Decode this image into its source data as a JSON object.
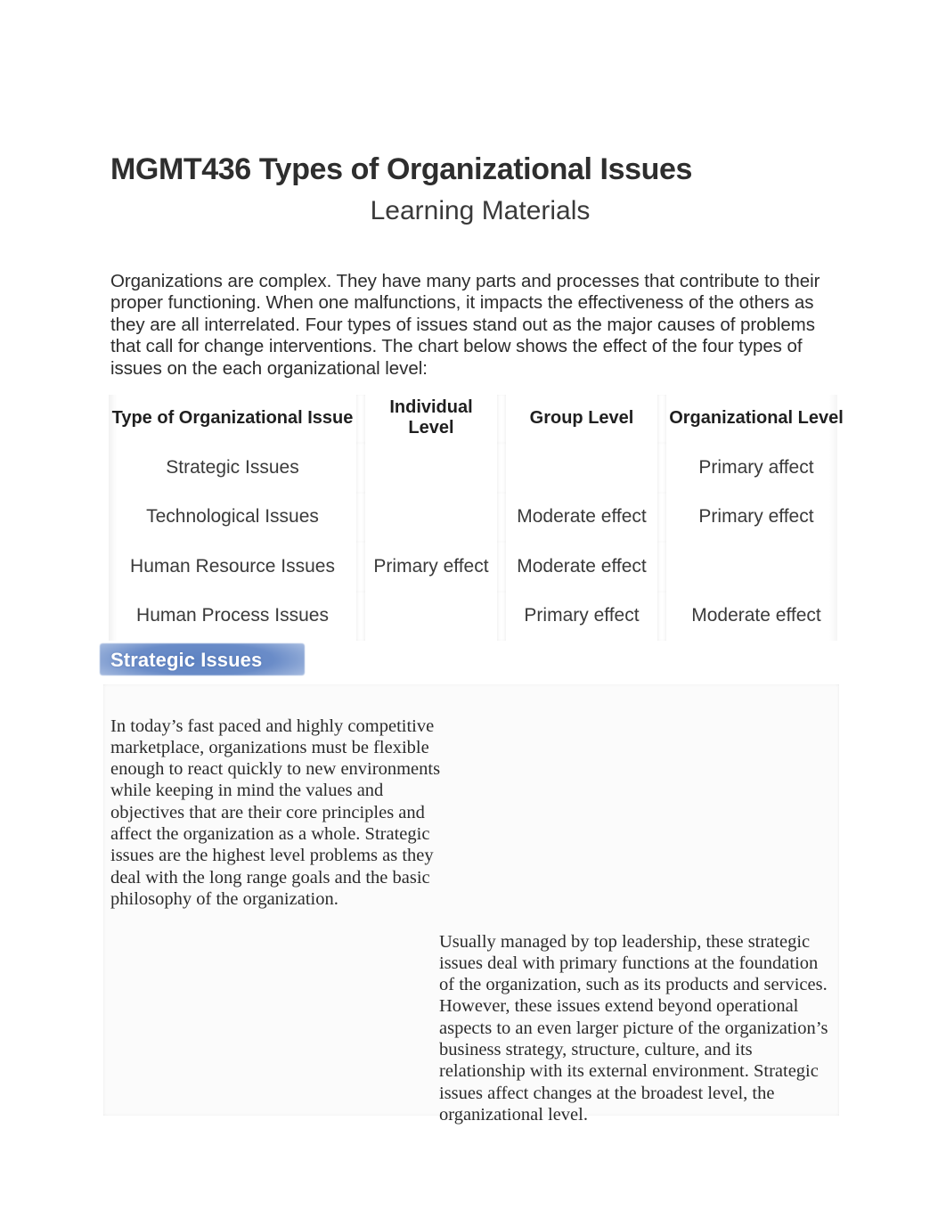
{
  "document": {
    "title": "MGMT436 Types of Organizational Issues",
    "subtitle": "Learning Materials",
    "intro": "Organizations are complex. They have many parts and processes that contribute to their proper functioning. When one malfunctions, it impacts the effectiveness of the others as they are all interrelated. Four types of issues stand out as the major causes of problems that call for change interventions. The chart below shows the effect of the four types of issues on the each organizational level:"
  },
  "table": {
    "headers": [
      "Type of Organizational Issue",
      "Individual Level",
      "Group Level",
      "Organizational Level"
    ],
    "rows": [
      {
        "issue": "Strategic Issues",
        "individual": "",
        "group": "",
        "organizational": "Primary affect"
      },
      {
        "issue": "Technological Issues",
        "individual": "",
        "group": "Moderate effect",
        "organizational": "Primary effect"
      },
      {
        "issue": "Human Resource Issues",
        "individual": "Primary effect",
        "group": "Moderate effect",
        "organizational": ""
      },
      {
        "issue": "Human Process Issues",
        "individual": "",
        "group": "Primary effect",
        "organizational": "Moderate effect"
      }
    ]
  },
  "section": {
    "heading": "Strategic Issues",
    "highlight_color": "#5e83c2",
    "heading_text_color": "#ffffff",
    "paragraph_left": "In today’s fast paced and highly competitive marketplace, organizations must be flexible enough to react quickly to new environments while keeping in mind the values and objectives that are their core principles and affect the organization as a whole. Strategic issues are the highest level problems as they deal with the long range goals and the basic philosophy of the organization.",
    "paragraph_right": "Usually managed by top leadership, these strategic issues deal with primary functions at the foundation of the organization, such as its products and services. However, these issues extend beyond operational aspects to an even larger picture of the organization’s business strategy, structure, culture, and its relationship with its external environment. Strategic issues affect changes at the broadest level, the organizational level."
  }
}
